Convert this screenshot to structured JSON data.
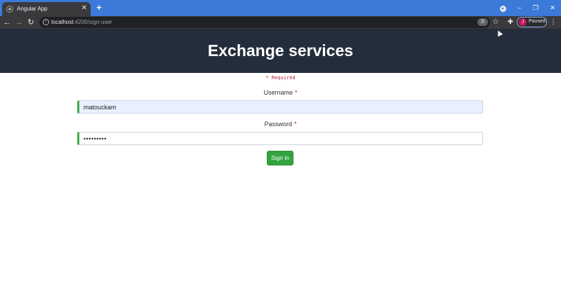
{
  "browser": {
    "tab_title": "Angular App",
    "tab_close": "✕",
    "new_tab": "+",
    "url_host": "localhost",
    "url_path": ":4200/sign-user",
    "profile_initial": "J",
    "profile_status": "Paused",
    "icons": {
      "back": "back-arrow-icon",
      "forward": "forward-arrow-icon",
      "reload": "reload-icon",
      "site_info": "info-icon",
      "password_key": "key-icon",
      "bookmark": "star-icon",
      "extensions": "puzzle-icon",
      "menu": "kebab-menu-icon"
    },
    "window_controls": [
      "–",
      "❐",
      "✕"
    ]
  },
  "page": {
    "title": "Exchange services",
    "required_note": "* Required",
    "form": {
      "username_label": "Username",
      "username_value": "matouckam",
      "password_label": "Password",
      "password_value": "matouckam",
      "required_marker": "*",
      "submit_label": "Sign in"
    }
  },
  "colors": {
    "tab_strip": "#3b7ad8",
    "toolbar": "#3a3a3c",
    "header_bg": "#232d3c",
    "valid_border": "#42a948",
    "required_red": "#b11f44",
    "button_green": "#35a33f",
    "autofill_bg": "#e8f0fe"
  }
}
